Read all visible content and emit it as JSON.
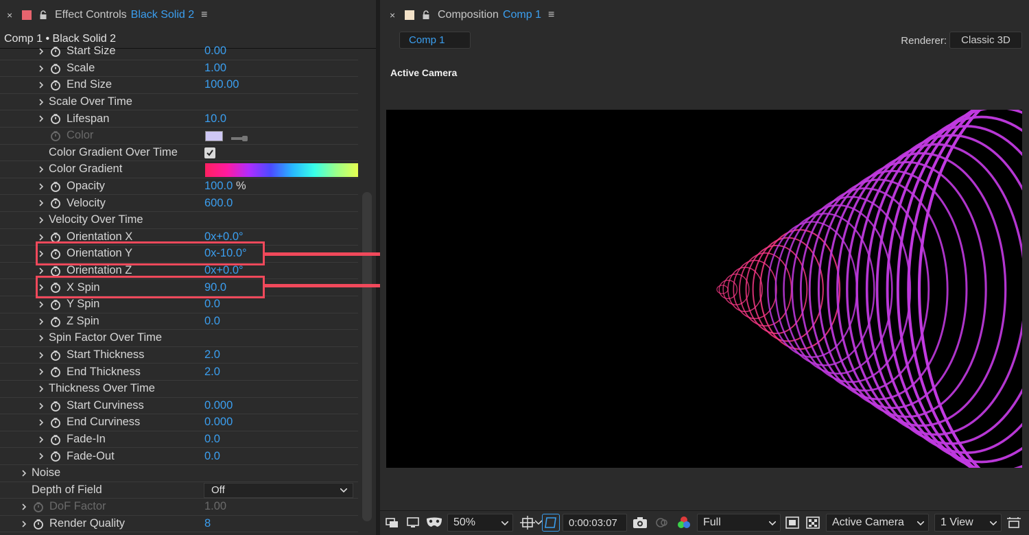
{
  "effect_panel": {
    "tab_close": "×",
    "tab_title": "Effect Controls",
    "tab_target": "Black Solid 2",
    "tab_menu": "≡",
    "layer_title": "Comp 1 • Black Solid 2",
    "layer_swatch_color": "#e8646e",
    "properties": [
      {
        "name": "Start Size",
        "value": "0.00"
      },
      {
        "name": "Scale",
        "value": "1.00"
      },
      {
        "name": "End Size",
        "value": "100.00"
      },
      {
        "name": "Scale Over Time",
        "value": ""
      },
      {
        "name": "Lifespan",
        "value": "10.0"
      },
      {
        "name": "Color",
        "value": ""
      },
      {
        "name": "Color Gradient Over Time",
        "value": ""
      },
      {
        "name": "Color Gradient",
        "value": ""
      },
      {
        "name": "Opacity",
        "value": "100.0",
        "unit": "%"
      },
      {
        "name": "Velocity",
        "value": "600.0"
      },
      {
        "name": "Velocity Over Time",
        "value": ""
      },
      {
        "name": "Orientation X",
        "value": "0x+0.0°"
      },
      {
        "name": "Orientation Y",
        "value": "0x-10.0°"
      },
      {
        "name": "Orientation Z",
        "value": "0x+0.0°"
      },
      {
        "name": "X Spin",
        "value": "90.0"
      },
      {
        "name": "Y Spin",
        "value": "0.0"
      },
      {
        "name": "Z Spin",
        "value": "0.0"
      },
      {
        "name": "Spin Factor Over Time",
        "value": ""
      },
      {
        "name": "Start Thickness",
        "value": "2.0"
      },
      {
        "name": "End Thickness",
        "value": "2.0"
      },
      {
        "name": "Thickness Over Time",
        "value": ""
      },
      {
        "name": "Start Curviness",
        "value": "0.000"
      },
      {
        "name": "End Curviness",
        "value": "0.000"
      },
      {
        "name": "Fade-In",
        "value": "0.0"
      },
      {
        "name": "Fade-Out",
        "value": "0.0"
      },
      {
        "name": "Noise",
        "value": ""
      },
      {
        "name": "Depth of Field",
        "value": "Off"
      },
      {
        "name": "DoF Factor",
        "value": "1.00"
      },
      {
        "name": "Render Quality",
        "value": "8"
      }
    ],
    "color_gradient_over_time_checked": true,
    "color_chip": "#cfc8f5"
  },
  "composition_panel": {
    "tab_close": "×",
    "tab_title": "Composition",
    "tab_target": "Comp 1",
    "tab_menu": "≡",
    "tab_swatch_color": "#f3e2c8",
    "subtab": "Comp 1",
    "renderer_label": "Renderer:",
    "renderer_value": "Classic 3D",
    "viewer_label": "Active Camera",
    "ring_color": "#c13ae0",
    "ring_color_tip": "#ff3a8a"
  },
  "bottom_bar": {
    "zoom": "50%",
    "timecode": "0:00:03:07",
    "resolution": "Full",
    "camera": "Active Camera",
    "views": "1 View"
  },
  "annotation_color": "#f0495b"
}
